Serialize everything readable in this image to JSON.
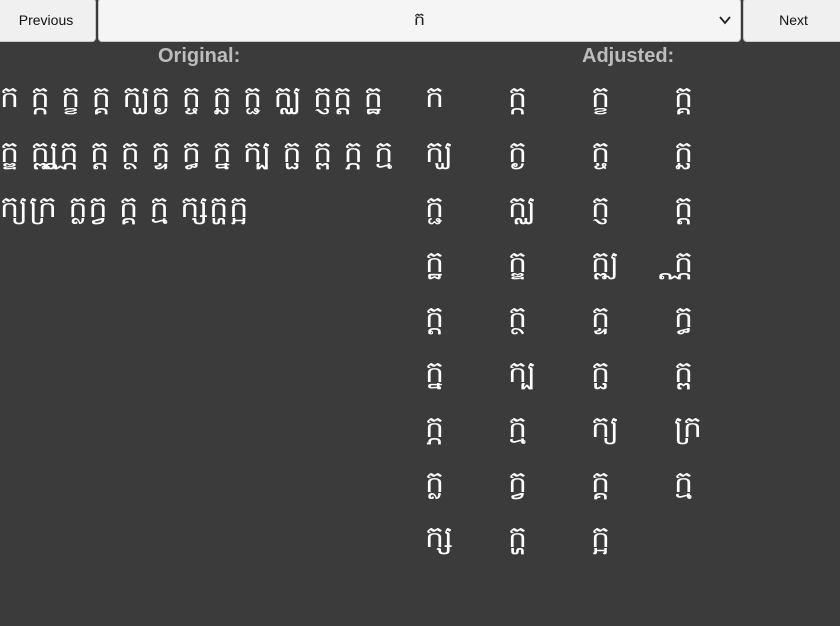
{
  "toolbar": {
    "previous_label": "Previous",
    "next_label": "Next",
    "selected_char": "ក"
  },
  "headings": {
    "original": "Original:",
    "adjusted": "Adjusted:"
  },
  "original_text": "ក ក្ក ក្ខ ក្គ ក្ឃក្ង ក្ច ក្ឆ ក្ជ ក្ឈ ក្ញក្ដ ក្ឋ ក្ឌ ក្ឍក្ណ ក្ត ក្ថ ក្ទ ក្ធ ក្ន ក្ប ក្ផ ក្ព ក្ភ ក្ម ក្យក្រ ក្លក្វ ក្គ ក្ម ក្សក្ហក្អ",
  "adjusted_cells": [
    "ក",
    "ក្ក",
    "ក្ខ",
    "ក្គ",
    "ក្ឃ",
    "ក្ង",
    "ក្ច",
    "ក្ឆ",
    "ក្ជ",
    "ក្ឈ",
    "ក្ញ",
    "ក្ដ",
    "ក្ឋ",
    "ក្ឌ",
    "ក្ឍ",
    "ក្ណ",
    "ក្ត",
    "ក្ថ",
    "ក្ទ",
    "ក្ធ",
    "ក្ន",
    "ក្ប",
    "ក្ផ",
    "ក្ព",
    "ក្ភ",
    "ក្ម",
    "ក្យ",
    "ក្រ",
    "ក្ល",
    "ក្វ",
    "ក្គ",
    "ក្ម",
    "ក្ស",
    "ក្ហ",
    "ក្អ"
  ]
}
